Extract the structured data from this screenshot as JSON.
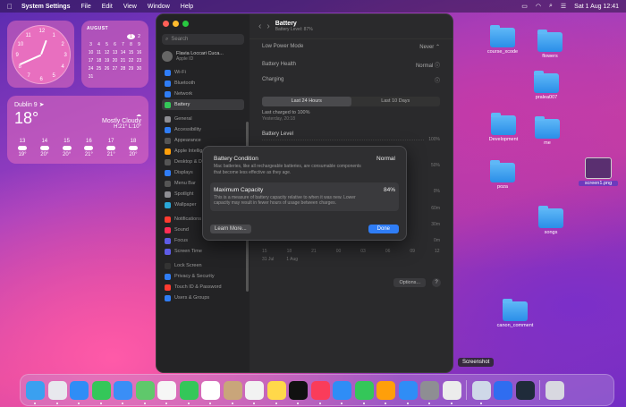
{
  "menubar": {
    "app": "System Settings",
    "items": [
      "File",
      "Edit",
      "View",
      "Window",
      "Help"
    ],
    "datetime": "Sat 1 Aug  12:41"
  },
  "clock": {
    "numerals": [
      "12",
      "1",
      "2",
      "3",
      "4",
      "5",
      "6",
      "7",
      "8",
      "9",
      "10",
      "11"
    ]
  },
  "calendar": {
    "month": "AUGUST",
    "days": [
      "",
      "",
      "",
      "",
      "",
      "1",
      "2",
      "3",
      "4",
      "5",
      "6",
      "7",
      "8",
      "9",
      "10",
      "11",
      "12",
      "13",
      "14",
      "15",
      "16",
      "17",
      "18",
      "19",
      "20",
      "21",
      "22",
      "23",
      "24",
      "25",
      "26",
      "27",
      "28",
      "29",
      "30",
      "31"
    ],
    "today": "1"
  },
  "weather": {
    "city": "Dublin 9",
    "temp": "18°",
    "condition": "Mostly Cloudy",
    "range": "H:21° L:10°",
    "hours": [
      {
        "h": "13",
        "t": "19°"
      },
      {
        "h": "14",
        "t": "20°"
      },
      {
        "h": "15",
        "t": "20°"
      },
      {
        "h": "16",
        "t": "21°"
      },
      {
        "h": "17",
        "t": "21°"
      },
      {
        "h": "18",
        "t": "20°"
      }
    ]
  },
  "sidebar": {
    "search": "Search",
    "profile_name": "Flavia Loccari Cuca...",
    "profile_sub": "Apple ID",
    "items": [
      {
        "label": "Wi-Fi",
        "color": "#2f7df6"
      },
      {
        "label": "Bluetooth",
        "color": "#2f7df6"
      },
      {
        "label": "Network",
        "color": "#2f7df6"
      },
      {
        "label": "Battery",
        "color": "#34c759",
        "sel": true
      },
      {
        "gap": true
      },
      {
        "label": "General",
        "color": "#8e8e93"
      },
      {
        "label": "Accessibility",
        "color": "#2f7df6"
      },
      {
        "label": "Appearance",
        "color": "#555"
      },
      {
        "label": "Apple Intelligence",
        "color": "#ff9f0a"
      },
      {
        "label": "Desktop & Dock",
        "color": "#555"
      },
      {
        "label": "Displays",
        "color": "#2f7df6"
      },
      {
        "label": "Menu Bar",
        "color": "#555"
      },
      {
        "label": "Spotlight",
        "color": "#8e8e93"
      },
      {
        "label": "Wallpaper",
        "color": "#2aa8d8"
      },
      {
        "gap": true
      },
      {
        "label": "Notifications",
        "color": "#ff3b30"
      },
      {
        "label": "Sound",
        "color": "#ff2d55"
      },
      {
        "label": "Focus",
        "color": "#5e5ce6"
      },
      {
        "label": "Screen Time",
        "color": "#5e5ce6"
      },
      {
        "gap": true
      },
      {
        "label": "Lock Screen",
        "color": "#333"
      },
      {
        "label": "Privacy & Security",
        "color": "#2f7df6"
      },
      {
        "label": "Touch ID & Password",
        "color": "#ff3b30"
      },
      {
        "label": "Users & Groups",
        "color": "#2f7df6"
      }
    ]
  },
  "battery": {
    "title": "Battery",
    "subtitle": "Battery Level: 87%",
    "low_power_label": "Low Power Mode",
    "low_power_value": "Never",
    "health_label": "Battery Health",
    "health_value": "Normal",
    "charging_label": "Charging",
    "tab1": "Last 24 Hours",
    "tab2": "Last 10 Days",
    "charged": "Last charged to 100%",
    "charged_when": "Yesterday, 20:18",
    "level_label": "Battery Level",
    "y_labels": [
      "100%",
      "50%",
      "0%",
      "60m",
      "30m",
      "0m"
    ],
    "x_labels": [
      "15",
      "18",
      "21",
      "00",
      "03",
      "06",
      "09",
      "12"
    ],
    "x_dates": "31 Jul          1 Aug",
    "options": "Options...",
    "help": "?"
  },
  "dialog": {
    "cond_label": "Battery Condition",
    "cond_value": "Normal",
    "cond_desc": "Mac batteries, like all rechargeable batteries, are consumable components that become less effective as they age.",
    "cap_label": "Maximum Capacity",
    "cap_value": "84%",
    "cap_desc": "This is a measure of battery capacity relative to when it was new. Lower capacity may result in fewer hours of usage between charges.",
    "learn": "Learn More...",
    "done": "Done"
  },
  "desktop": {
    "folders": [
      "course_xcode",
      "flowers",
      "pralea007",
      "Development",
      "me",
      "poza",
      "songs",
      "canon_comment"
    ],
    "screenshot": "screen1.png"
  },
  "tooltip": "Screenshot",
  "dock": [
    {
      "name": "finder",
      "color": "#3aa0f0"
    },
    {
      "name": "launchpad",
      "color": "#e8e8ee"
    },
    {
      "name": "safari",
      "color": "#2f8df6"
    },
    {
      "name": "messages",
      "color": "#34c759"
    },
    {
      "name": "mail",
      "color": "#3a8ef6"
    },
    {
      "name": "maps",
      "color": "#5fc86b"
    },
    {
      "name": "photos",
      "color": "#f6f6f6"
    },
    {
      "name": "facetime",
      "color": "#34c759"
    },
    {
      "name": "calendar",
      "color": "#ffffff"
    },
    {
      "name": "contacts",
      "color": "#c9a57a"
    },
    {
      "name": "reminders",
      "color": "#f2f2f2"
    },
    {
      "name": "notes",
      "color": "#ffd84a"
    },
    {
      "name": "tv",
      "color": "#111111"
    },
    {
      "name": "music",
      "color": "#fa3c5a"
    },
    {
      "name": "keynote",
      "color": "#2f8df6"
    },
    {
      "name": "numbers",
      "color": "#34c759"
    },
    {
      "name": "pages",
      "color": "#ff9f0a"
    },
    {
      "name": "app-store",
      "color": "#2f8df6"
    },
    {
      "name": "system-settings",
      "color": "#8e8e93"
    },
    {
      "name": "screenshot",
      "color": "#ececec"
    },
    {
      "sep": true
    },
    {
      "name": "disk-utility",
      "color": "#cfd8e8"
    },
    {
      "name": "quicktime",
      "color": "#2f6df0"
    },
    {
      "name": "davinci",
      "color": "#1f2b3a"
    },
    {
      "sep": true
    },
    {
      "name": "trash",
      "color": "#d8d8e0"
    }
  ]
}
